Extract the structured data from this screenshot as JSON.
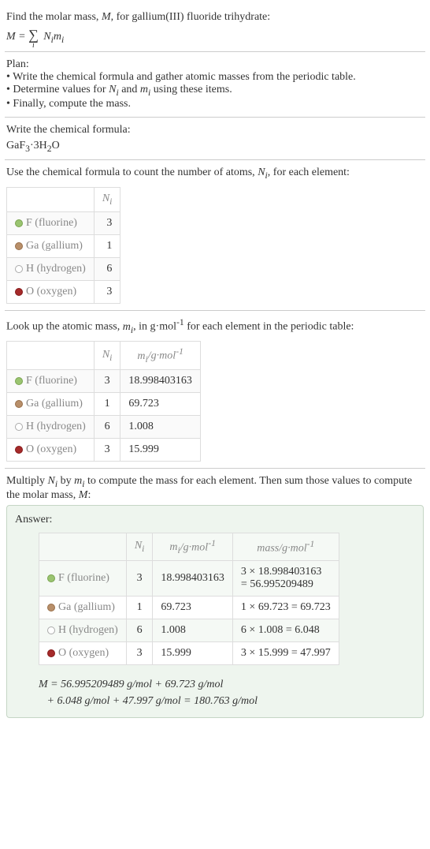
{
  "intro": {
    "line1": "Find the molar mass, ",
    "line1_var": "M",
    "line1_end": ", for gallium(III) fluoride trihydrate:"
  },
  "plan": {
    "title": "Plan:",
    "items": [
      "Write the chemical formula and gather atomic masses from the periodic table.",
      "Determine values for N_i and m_i using these items.",
      "Finally, compute the mass."
    ],
    "item1": "Write the chemical formula and gather atomic masses from the periodic table.",
    "item2a": "Determine values for ",
    "item2b": " and ",
    "item2c": " using these items.",
    "item3": "Finally, compute the mass."
  },
  "chemformula": {
    "title": "Write the chemical formula:",
    "formula_parts": {
      "p1": "GaF",
      "p2": "3",
      "p3": "·3H",
      "p4": "2",
      "p5": "O"
    }
  },
  "count_section": {
    "intro_a": "Use the chemical formula to count the number of atoms, ",
    "intro_b": ", for each element:"
  },
  "elements": {
    "f": {
      "sym": "F",
      "name": "(fluorine)",
      "n": "3",
      "m": "18.998403163"
    },
    "ga": {
      "sym": "Ga",
      "name": "(gallium)",
      "n": "1",
      "m": "69.723"
    },
    "h": {
      "sym": "H",
      "name": "(hydrogen)",
      "n": "6",
      "m": "1.008"
    },
    "o": {
      "sym": "O",
      "name": "(oxygen)",
      "n": "3",
      "m": "15.999"
    }
  },
  "lookup_section": {
    "intro_a": "Look up the atomic mass, ",
    "intro_b": ", in g·mol",
    "intro_c": " for each element in the periodic table:"
  },
  "headers": {
    "ni_html": "N_i",
    "mi_header": "m_i/g·mol^-1",
    "mass_header": "mass/g·mol^-1"
  },
  "multiply_section": {
    "intro_a": "Multiply ",
    "intro_b": " by ",
    "intro_c": " to compute the mass for each element. Then sum those values to compute the molar mass, ",
    "intro_d": ":"
  },
  "answer": {
    "title": "Answer:",
    "rows": {
      "f": {
        "mass_calc_a": "3 × 18.998403163",
        "mass_calc_b": "= 56.995209489"
      },
      "ga": {
        "mass_calc": "1 × 69.723 = 69.723"
      },
      "h": {
        "mass_calc": "6 × 1.008 = 6.048"
      },
      "o": {
        "mass_calc": "3 × 15.999 = 47.997"
      }
    },
    "final_a": "M",
    "final_b": " = 56.995209489 g/mol + 69.723 g/mol",
    "final_c": "+ 6.048 g/mol + 47.997 g/mol = 180.763 g/mol"
  },
  "chart_data": {
    "type": "table",
    "title": "Molar mass calculation for GaF3·3H2O",
    "elements": [
      {
        "element": "F (fluorine)",
        "N_i": 3,
        "m_i_g_per_mol": 18.998403163,
        "mass_g_per_mol": 56.995209489
      },
      {
        "element": "Ga (gallium)",
        "N_i": 1,
        "m_i_g_per_mol": 69.723,
        "mass_g_per_mol": 69.723
      },
      {
        "element": "H (hydrogen)",
        "N_i": 6,
        "m_i_g_per_mol": 1.008,
        "mass_g_per_mol": 6.048
      },
      {
        "element": "O (oxygen)",
        "N_i": 3,
        "m_i_g_per_mol": 15.999,
        "mass_g_per_mol": 47.997
      }
    ],
    "molar_mass_g_per_mol": 180.763
  }
}
